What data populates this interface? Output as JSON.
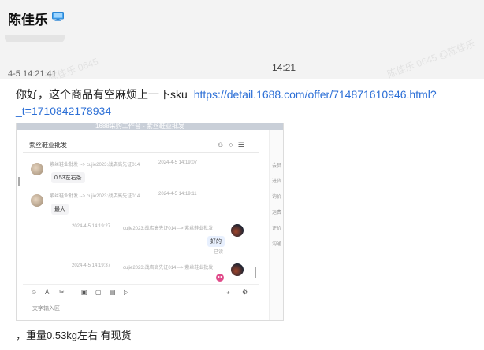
{
  "header": {
    "title": "陈佳乐",
    "icon": "computer-icon"
  },
  "conversation": {
    "message_time": "4-5 14:21:41",
    "center_time": "14:21",
    "watermarks": [
      "陈佳乐 0645",
      "陈佳乐 0645 @陈佳乐"
    ]
  },
  "message": {
    "text": "你好，这个商品有空麻烦上一下sku",
    "link_part1": "https://detail.1688.com/offer/714871610946.html?",
    "link_part2": "_t=1710842178934",
    "footer": "，重量0.53kg左右    有现货"
  },
  "screenshot": {
    "top_bar": "1688采购工作台 - 紫丝鞋业批发",
    "chat_title": "紫丝鞋业批发",
    "messages": [
      {
        "sender": "紫丝鞋业批发 --> cujie2023:战店高先证014",
        "time": "2024-4-5 14:19:07",
        "text": "0.53左右条"
      },
      {
        "sender": "紫丝鞋业批发 --> cujie2023:战店高先证014",
        "time": "2024-4-5 14:19:11",
        "text": "最大"
      },
      {
        "sender": "cujie2023:战店高先证014 --> 紫丝鞋业批发",
        "time": "2024-4-5 14:19:27",
        "text": "好的",
        "status": "已读"
      },
      {
        "sender": "cujie2023:战店高先证014 --> 紫丝鞋业批发",
        "time": "2024-4-5 14:19:37",
        "text": ""
      }
    ],
    "input_placeholder": "文字输入区",
    "right_panel": [
      "会员",
      "进货",
      "询价",
      "运费",
      "评价",
      "沟通"
    ]
  }
}
